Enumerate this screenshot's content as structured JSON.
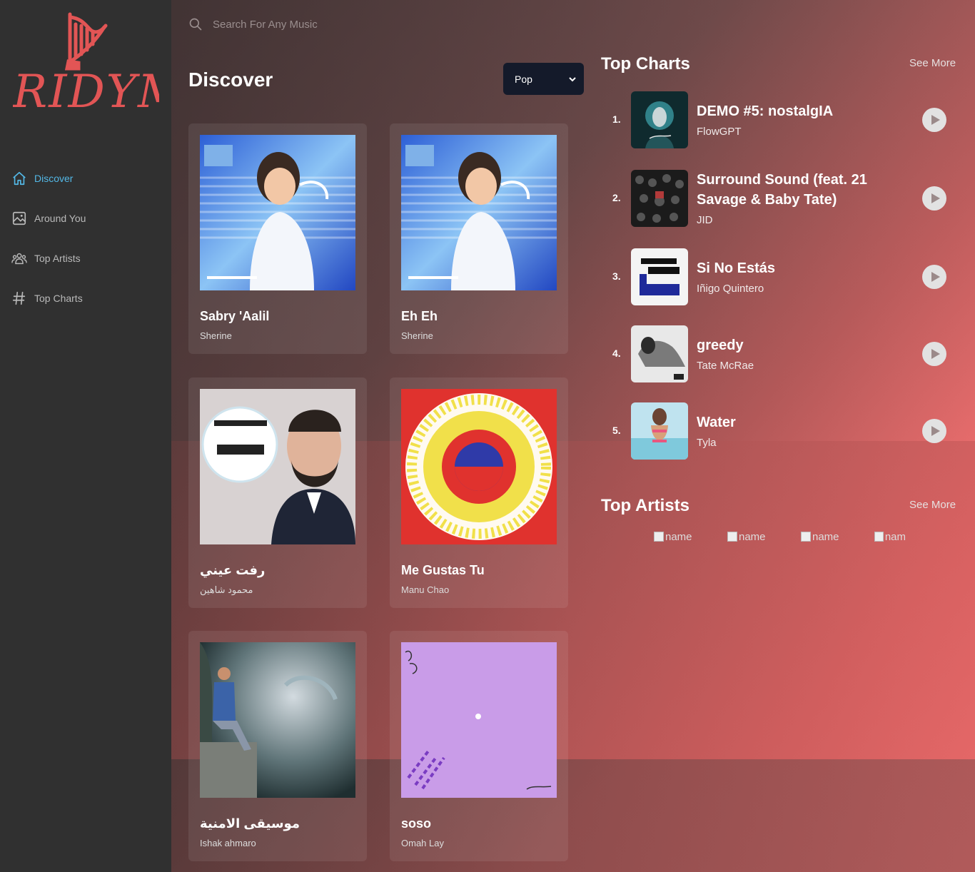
{
  "app": {
    "logo_text": "RIDYM",
    "brand_color": "#e25555"
  },
  "sidebar": {
    "items": [
      {
        "label": "Discover",
        "icon": "home-icon",
        "active": true
      },
      {
        "label": "Around You",
        "icon": "image-icon",
        "active": false
      },
      {
        "label": "Top Artists",
        "icon": "users-icon",
        "active": false
      },
      {
        "label": "Top Charts",
        "icon": "hash-icon",
        "active": false
      }
    ]
  },
  "search": {
    "placeholder": "Search For Any Music",
    "icon": "search-icon"
  },
  "discover": {
    "title": "Discover",
    "genre_selected": "Pop",
    "songs": [
      {
        "title": "Sabry 'Aalil",
        "artist": "Sherine"
      },
      {
        "title": "Eh Eh",
        "artist": "Sherine"
      },
      {
        "title": "رفت عيني",
        "artist": "محمود شاهين"
      },
      {
        "title": "Me Gustas Tu",
        "artist": "Manu Chao"
      },
      {
        "title": "موسيقى الامنية",
        "artist": "Ishak ahmaro"
      },
      {
        "title": "soso",
        "artist": "Omah Lay"
      }
    ]
  },
  "top_charts": {
    "title": "Top Charts",
    "see_more": "See More",
    "items": [
      {
        "rank": "1.",
        "title": "DEMO #5: nostalgIA",
        "artist": "FlowGPT"
      },
      {
        "rank": "2.",
        "title": "Surround Sound (feat. 21 Savage & Baby Tate)",
        "artist": "JID"
      },
      {
        "rank": "3.",
        "title": "Si No Estás",
        "artist": "Iñigo Quintero"
      },
      {
        "rank": "4.",
        "title": "greedy",
        "artist": "Tate McRae"
      },
      {
        "rank": "5.",
        "title": "Water",
        "artist": "Tyla"
      }
    ]
  },
  "top_artists": {
    "title": "Top Artists",
    "see_more": "See More",
    "items": [
      {
        "alt": "name"
      },
      {
        "alt": "name"
      },
      {
        "alt": "name"
      },
      {
        "alt": "nam"
      }
    ]
  }
}
